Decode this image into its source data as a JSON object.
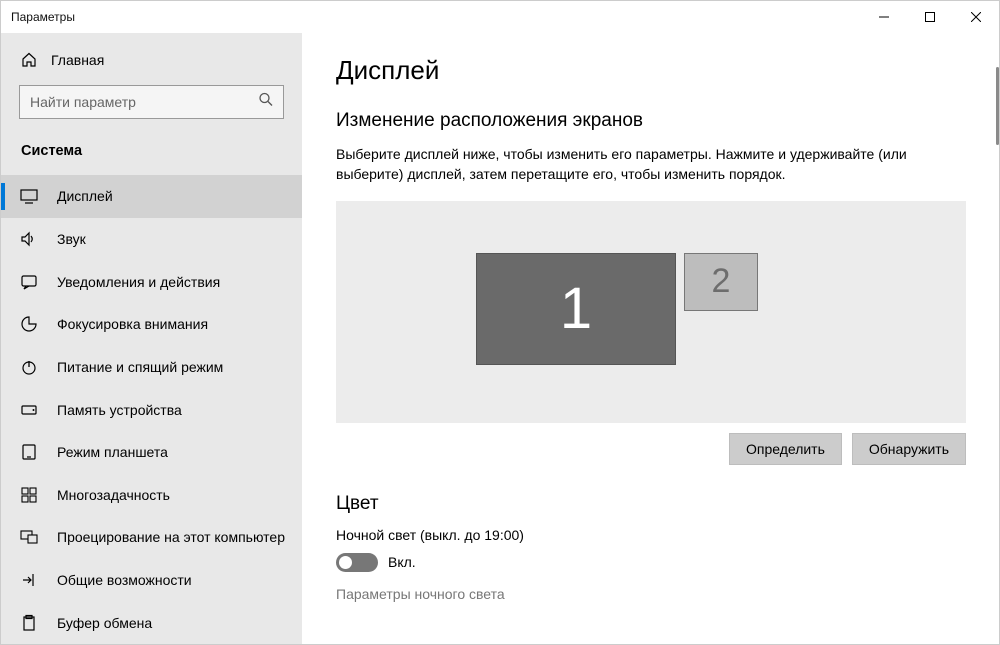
{
  "window": {
    "title": "Параметры"
  },
  "sidebar": {
    "home_label": "Главная",
    "search_placeholder": "Найти параметр",
    "category_label": "Система",
    "items": [
      {
        "label": "Дисплей"
      },
      {
        "label": "Звук"
      },
      {
        "label": "Уведомления и действия"
      },
      {
        "label": "Фокусировка внимания"
      },
      {
        "label": "Питание и спящий режим"
      },
      {
        "label": "Память устройства"
      },
      {
        "label": "Режим планшета"
      },
      {
        "label": "Многозадачность"
      },
      {
        "label": "Проецирование на этот компьютер"
      },
      {
        "label": "Общие возможности"
      },
      {
        "label": "Буфер обмена"
      }
    ]
  },
  "content": {
    "page_title": "Дисплей",
    "section1_title": "Изменение расположения экранов",
    "section1_text": "Выберите дисплей ниже, чтобы изменить его параметры. Нажмите и удерживайте (или выберите) дисплей, затем перетащите его, чтобы изменить порядок.",
    "monitor1_label": "1",
    "monitor2_label": "2",
    "identify_label": "Определить",
    "detect_label": "Обнаружить",
    "section2_title": "Цвет",
    "nightlight_label": "Ночной свет (выкл. до 19:00)",
    "toggle_label": "Вкл.",
    "toggle_state": "off",
    "nightlight_link": "Параметры ночного света"
  }
}
